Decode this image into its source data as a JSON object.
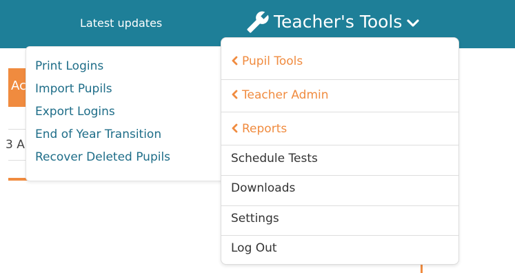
{
  "header": {
    "latest_updates": "Latest updates",
    "teachers_tools": "Teacher's Tools",
    "colors": {
      "bar": "#1e7f98",
      "text": "#ffffff"
    }
  },
  "background": {
    "button_fragment": "Ac",
    "field_fragment": "3 A"
  },
  "submenu": {
    "items": [
      "Print Logins",
      "Import Pupils",
      "Export Logins",
      "End of Year Transition",
      "Recover Deleted Pupils"
    ]
  },
  "dropdown": {
    "items": [
      {
        "label": "Pupil Tools",
        "icon": "chevron-left-icon",
        "style": "orange"
      },
      {
        "label": "Teacher Admin",
        "icon": "chevron-left-icon",
        "style": "orange"
      },
      {
        "label": "Reports",
        "icon": "chevron-left-icon",
        "style": "orange"
      },
      {
        "label": "Schedule Tests",
        "style": "dark"
      },
      {
        "label": "Downloads",
        "style": "dark"
      },
      {
        "label": "Settings",
        "style": "dark"
      },
      {
        "label": "Log Out",
        "style": "dark"
      }
    ]
  },
  "icons": {
    "tools": "wrench-icon",
    "menu_toggle": "chevron-down-icon"
  },
  "colors": {
    "accent_orange": "#f08b3f",
    "link_blue": "#1e6d88",
    "text_dark": "#333333"
  }
}
